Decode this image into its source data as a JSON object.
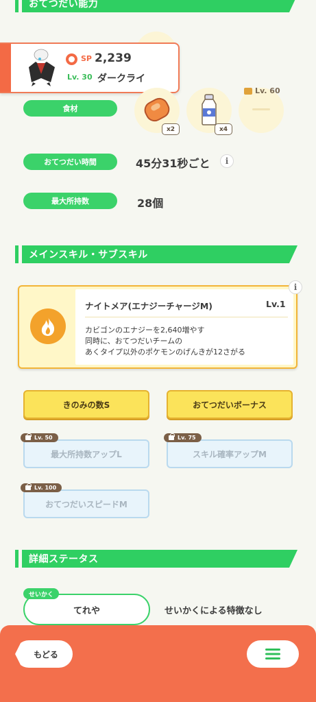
{
  "sections": {
    "help_ability": "おてつだい能力",
    "skills": "メインスキル・サブスキル",
    "details": "詳細ステータス"
  },
  "pokemon": {
    "sp_label": "SP",
    "sp_value": "2,239",
    "level": "Lv. 30",
    "name": "ダークライ"
  },
  "ingredients": {
    "label": "食材",
    "items": [
      {
        "name": "bean-sausage",
        "qty": "x2"
      },
      {
        "name": "moomoo-milk",
        "qty": "x4"
      },
      {
        "name": "locked-slot",
        "unlock_level": "Lv. 60"
      }
    ]
  },
  "help_time": {
    "label": "おてつだい時間",
    "value": "45分31秒ごと"
  },
  "max_carry": {
    "label": "最大所持数",
    "value": "28個"
  },
  "main_skill": {
    "name": "ナイトメア(エナジーチャージM)",
    "level": "Lv.1",
    "desc_line1": "カビゴンのエナジーを2,640増やす",
    "desc_line2": "同時に、おてつだいチームの",
    "desc_line3": "あくタイプ以外のポケモンのげんきが12さがる"
  },
  "sub_skills": [
    {
      "label": "きのみの数S",
      "locked": false
    },
    {
      "label": "おてつだいボーナス",
      "locked": false
    },
    {
      "label": "最大所持数アップL",
      "locked": true,
      "unlock_level": "Lv. 50"
    },
    {
      "label": "スキル確率アップM",
      "locked": true,
      "unlock_level": "Lv. 75"
    },
    {
      "label": "おてつだいスピードM",
      "locked": true,
      "unlock_level": "Lv. 100"
    }
  ],
  "nature": {
    "tag": "せいかく",
    "value": "てれや",
    "effect": "せいかくによる特徴なし"
  },
  "footer": {
    "back_label": "もどる"
  },
  "colors": {
    "accent_green": "#2fcf62",
    "footer_orange": "#f36f4c",
    "gold": "#fbe35a"
  }
}
